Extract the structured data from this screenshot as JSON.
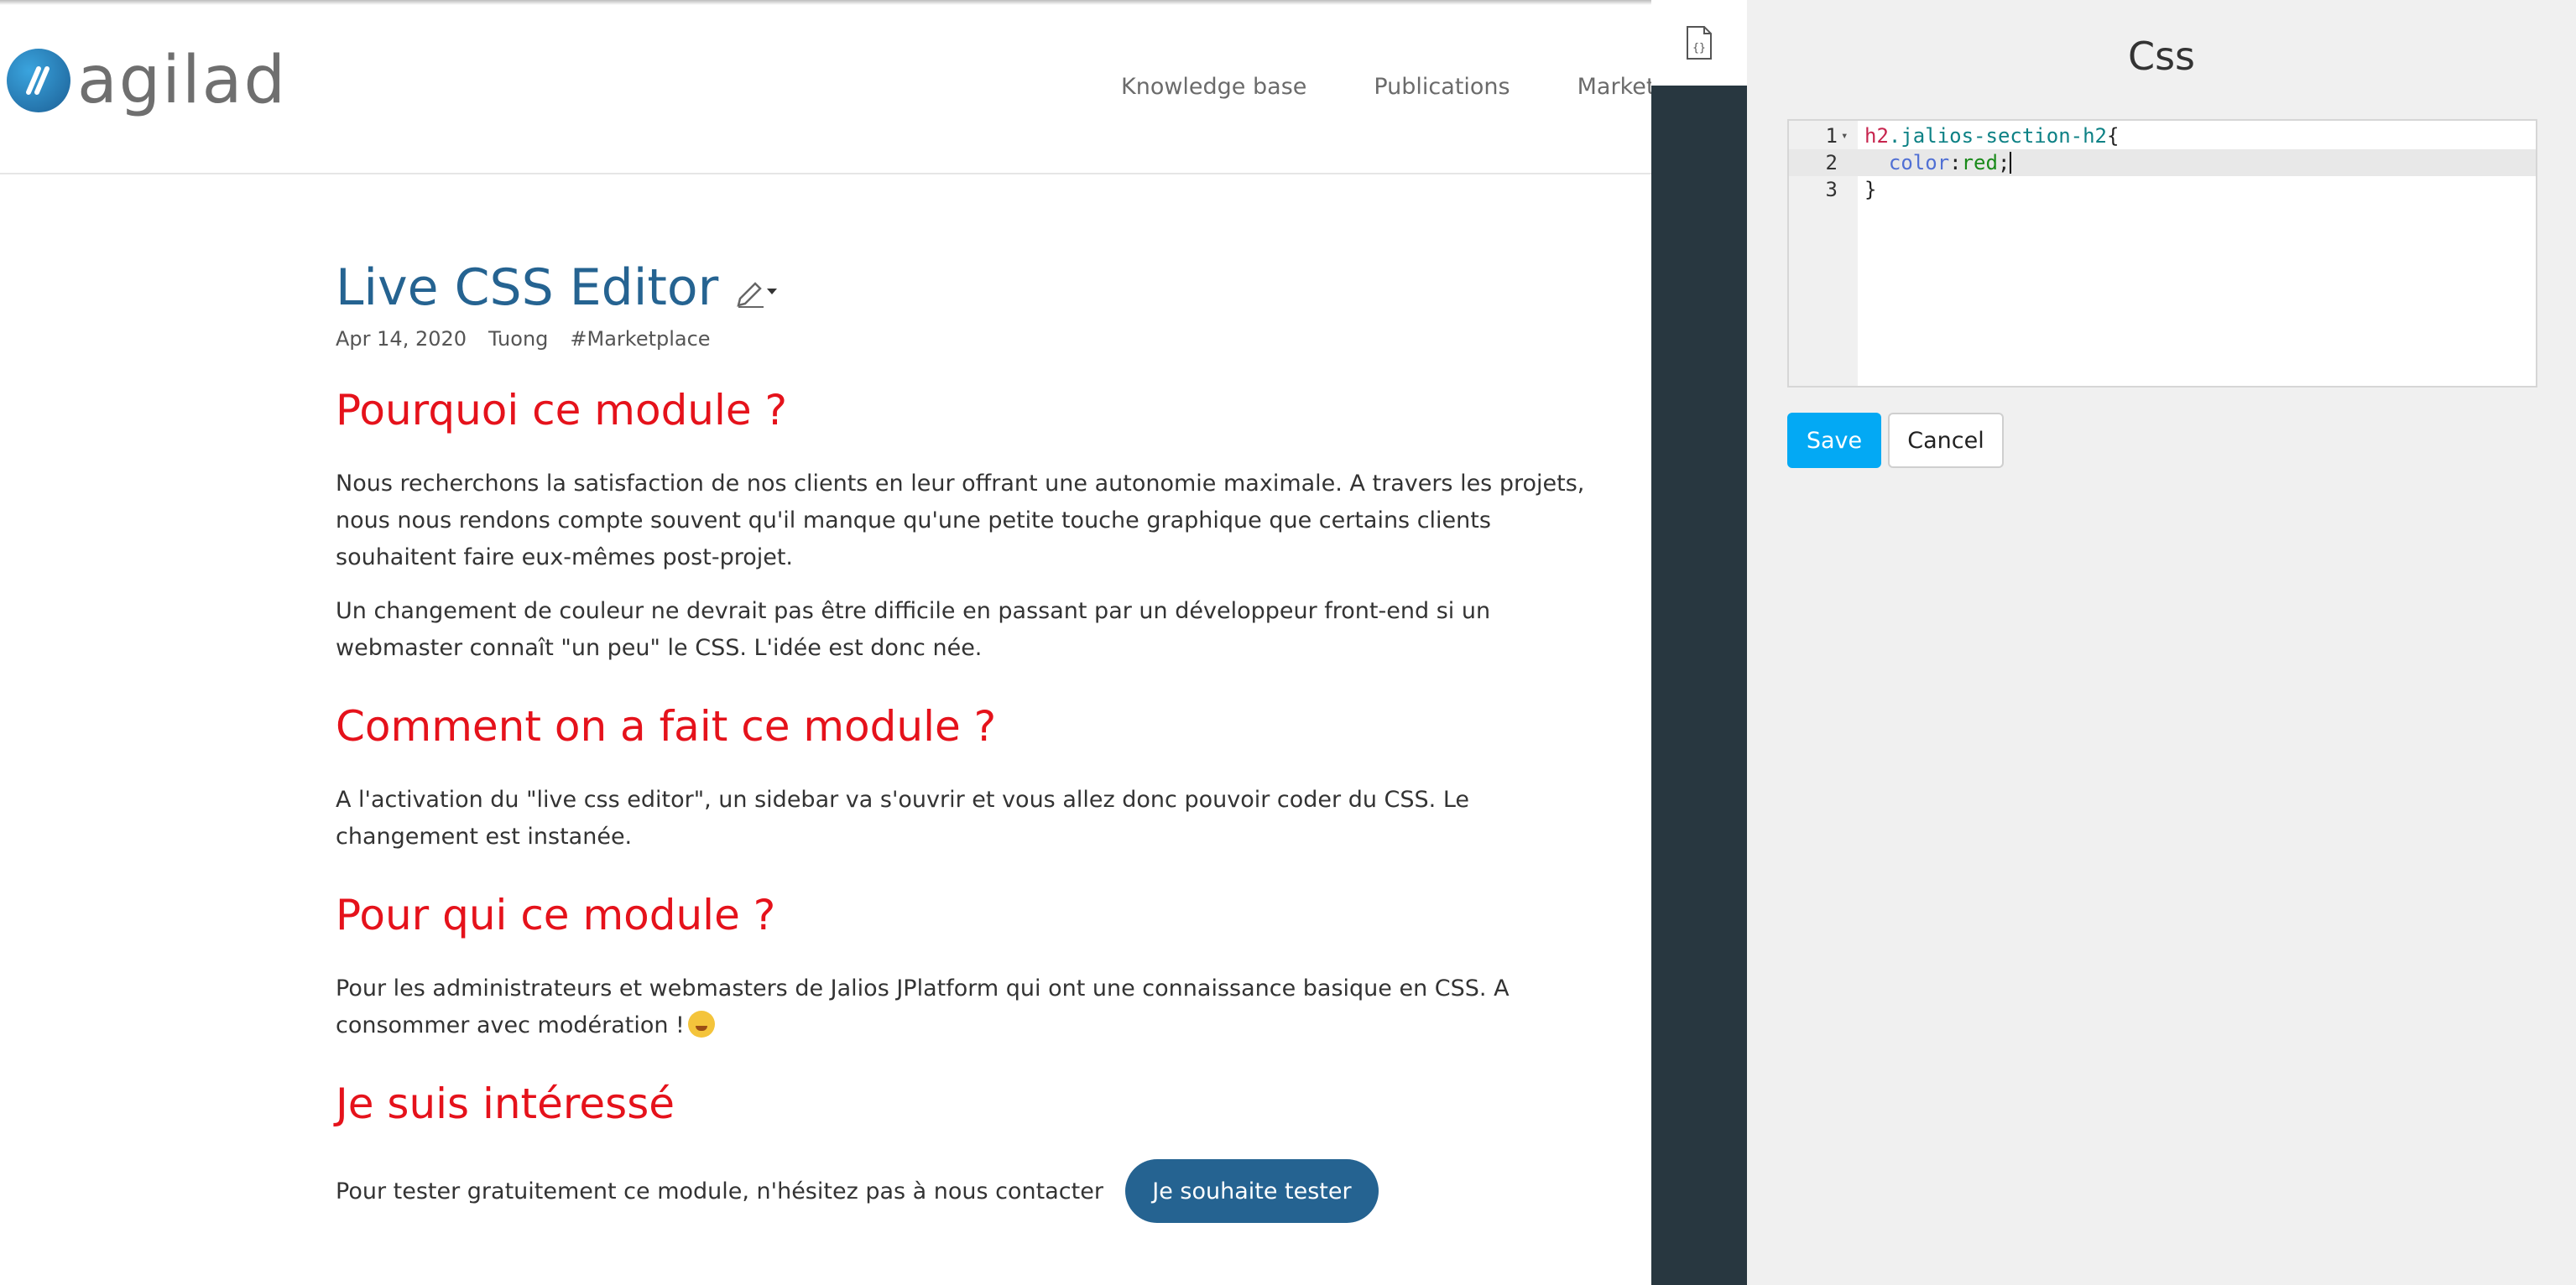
{
  "header": {
    "logo_text": "agilad",
    "nav": [
      "Knowledge base",
      "Publications",
      "Marketpla"
    ]
  },
  "article": {
    "title": "Live CSS Editor",
    "meta": {
      "date": "Apr 14, 2020",
      "author": "Tuong",
      "tag": "#Marketplace"
    },
    "sections": [
      {
        "heading": "Pourquoi ce module ?",
        "paragraphs": [
          "Nous recherchons la satisfaction de nos clients en leur offrant une autonomie maximale. A travers les projets, nous nous rendons compte souvent qu'il manque qu'une petite touche graphique que certains clients souhaitent faire eux-mêmes post-projet.",
          "Un changement de couleur ne devrait pas être difficile en passant par un développeur front-end si un webmaster connaît \"un peu\" le CSS. L'idée est donc née."
        ]
      },
      {
        "heading": "Comment on a fait ce module ?",
        "paragraphs": [
          "A l'activation du \"live css editor\", un sidebar va s'ouvrir et vous allez donc pouvoir coder du CSS. Le changement est instanée."
        ]
      },
      {
        "heading": "Pour qui ce module ?",
        "paragraphs": [
          "Pour les administrateurs et webmasters de Jalios JPlatform qui ont une connaissance basique en CSS. A consommer avec modération !"
        ]
      },
      {
        "heading": "Je suis intéressé",
        "cta_text": "Pour tester gratuitement ce module, n'hésitez pas à nous contacter",
        "cta_button": "Je souhaite tester"
      }
    ]
  },
  "panel": {
    "title": "Css",
    "editor": {
      "lines": [
        {
          "n": "1",
          "selector": "h2",
          "cls": ".jalios-section-h2",
          "rest": "{"
        },
        {
          "n": "2",
          "prop": "color",
          "value": "red"
        },
        {
          "n": "3",
          "rest": "}"
        }
      ]
    },
    "save_label": "Save",
    "cancel_label": "Cancel"
  },
  "colors": {
    "heading_red": "#e5121b",
    "title_blue": "#256391",
    "save_blue": "#03a9f4",
    "strip_dark": "#283740"
  },
  "icons": {
    "logo": "agilad-logo-icon",
    "edit": "pencil-icon",
    "css_file": "css-file-icon"
  }
}
